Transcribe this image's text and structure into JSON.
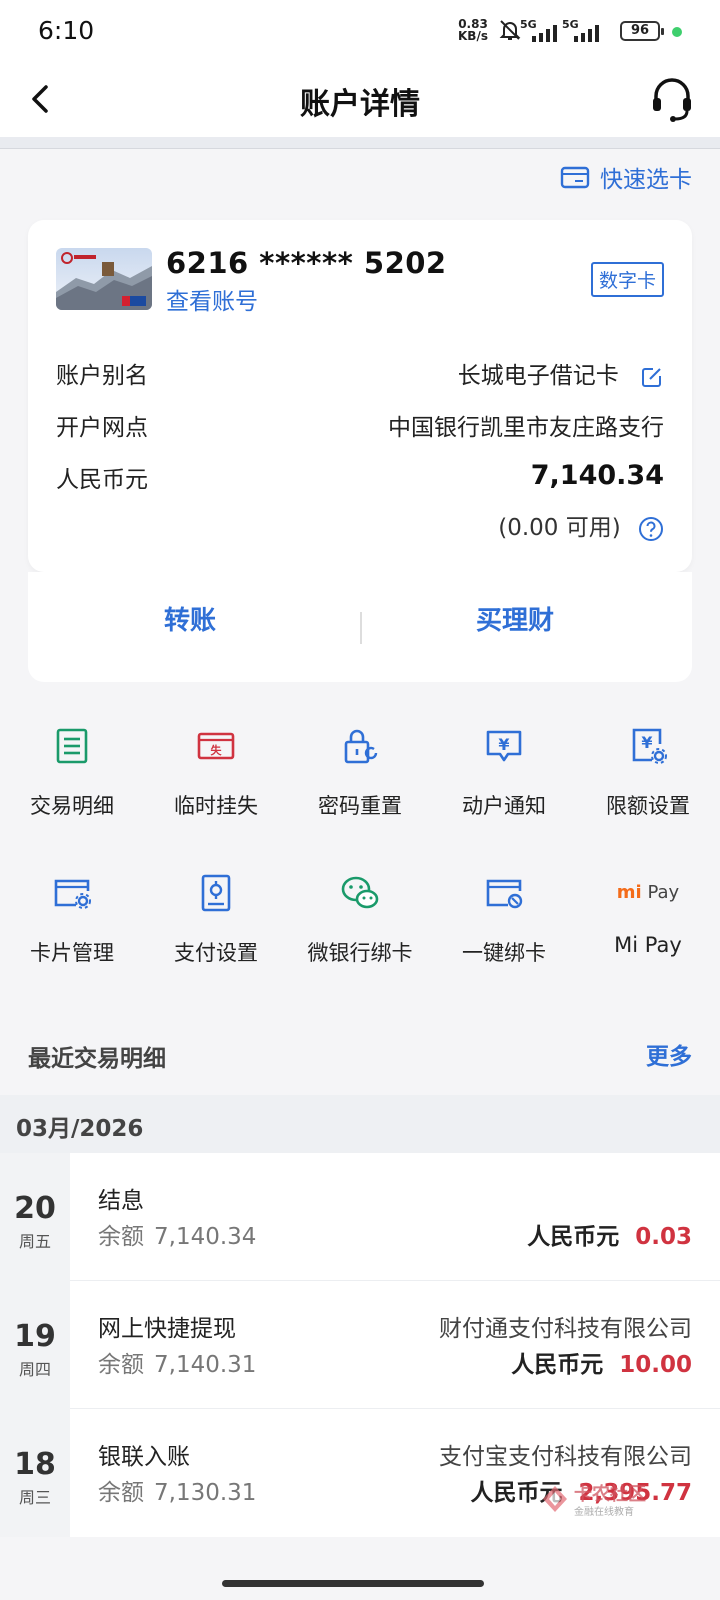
{
  "status_bar": {
    "time": "6:10",
    "net_speed_value": "0.83",
    "net_speed_unit": "KB/s",
    "sim1": "5G",
    "sim2": "5G",
    "battery": "96"
  },
  "header": {
    "title": "账户详情"
  },
  "quick_select": "快速选卡",
  "card": {
    "number": "6216 ****** 5202",
    "view_account": "查看账号",
    "badge": "数字卡",
    "rows": {
      "alias_label": "账户别名",
      "alias_value": "长城电子借记卡",
      "branch_label": "开户网点",
      "branch_value": "中国银行凯里市友庄路支行",
      "currency_label": "人民币元",
      "balance": "7,140.34",
      "available": "(0.00 可用)"
    },
    "actions": {
      "transfer": "转账",
      "wealth": "买理财"
    }
  },
  "functions": [
    {
      "label": "交易明细",
      "icon": "list-icon",
      "color": "#1a9a6a"
    },
    {
      "label": "临时挂失",
      "icon": "loss-report-icon",
      "color": "#d03340"
    },
    {
      "label": "密码重置",
      "icon": "lock-reset-icon",
      "color": "#2f6fd6"
    },
    {
      "label": "动户通知",
      "icon": "yuan-message-icon",
      "color": "#2f6fd6"
    },
    {
      "label": "限额设置",
      "icon": "yuan-settings-icon",
      "color": "#2f6fd6"
    },
    {
      "label": "卡片管理",
      "icon": "card-gear-icon",
      "color": "#2f6fd6"
    },
    {
      "label": "支付设置",
      "icon": "pay-settings-icon",
      "color": "#2f6fd6"
    },
    {
      "label": "微银行绑卡",
      "icon": "wechat-icon",
      "color": "#1a9a6a"
    },
    {
      "label": "一键绑卡",
      "icon": "card-bind-icon",
      "color": "#2f6fd6"
    },
    {
      "label": "Mi Pay",
      "icon": "mipay-logo",
      "logo_mi": "mi",
      "logo_pay": "Pay"
    }
  ],
  "recent": {
    "title": "最近交易明细",
    "more": "更多",
    "month": "03月/2026",
    "balance_label": "余额",
    "currency": "人民币元",
    "transactions": [
      {
        "day": "20",
        "weekday": "周五",
        "name": "结息",
        "balance": "7,140.34",
        "counterparty": "",
        "amount": "0.03"
      },
      {
        "day": "19",
        "weekday": "周四",
        "name": "网上快捷提现",
        "balance": "7,140.31",
        "counterparty": "财付通支付科技有限公司",
        "amount": "10.00"
      },
      {
        "day": "18",
        "weekday": "周三",
        "name": "银联入账",
        "balance": "7,130.31",
        "counterparty": "支付宝支付科技有限公司",
        "amount": "2,395.77"
      }
    ]
  },
  "watermark": {
    "title": "卡农社区",
    "subtitle": "金融在线教育"
  },
  "colors": {
    "accent": "#2f6fd6",
    "negative": "#d03340",
    "green": "#1a9a6a"
  }
}
